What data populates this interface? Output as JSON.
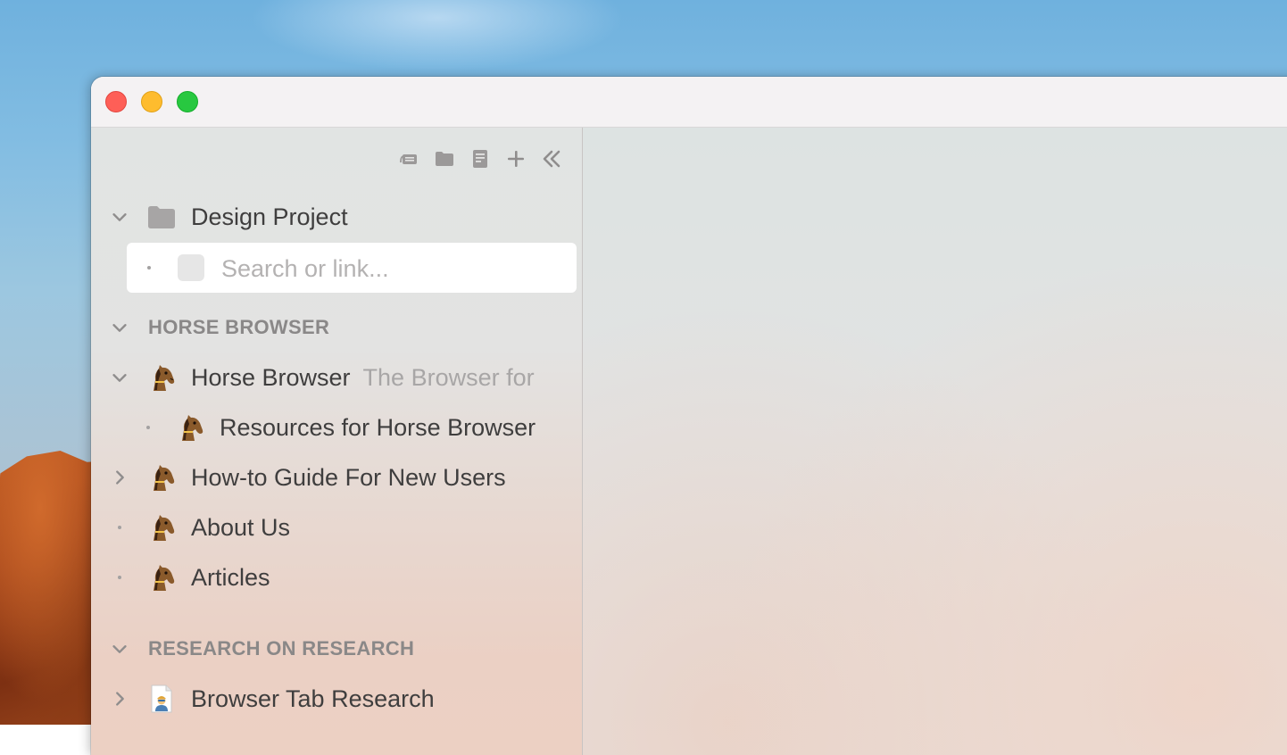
{
  "sidebar": {
    "toolbar": {
      "icons": [
        "web-link-icon",
        "folder-icon",
        "note-icon",
        "plus-icon",
        "collapse-sidebar-icon"
      ]
    },
    "project": {
      "label": "Design Project",
      "icon": "folder-icon"
    },
    "search": {
      "placeholder": "Search or link..."
    },
    "sections": [
      {
        "label": "HORSE BROWSER",
        "items": [
          {
            "label": "Horse Browser",
            "sublabel": "The Browser for",
            "icon": "horse-icon",
            "expanded": true
          },
          {
            "label": "Resources for Horse Browser",
            "icon": "horse-icon"
          },
          {
            "label": "How-to Guide For New Users",
            "icon": "horse-icon",
            "expanded": false
          },
          {
            "label": "About Us",
            "icon": "horse-icon"
          },
          {
            "label": "Articles",
            "icon": "horse-icon"
          }
        ]
      },
      {
        "label": "RESEARCH ON RESEARCH",
        "items": [
          {
            "label": "Browser Tab Research",
            "icon": "researcher-document-icon",
            "expanded": false
          }
        ]
      }
    ]
  },
  "colors": {
    "close": "#fe5f57",
    "minimize": "#febc2e",
    "zoom": "#28c840",
    "text": "#3f3e3e",
    "muted": "#8a8888"
  }
}
